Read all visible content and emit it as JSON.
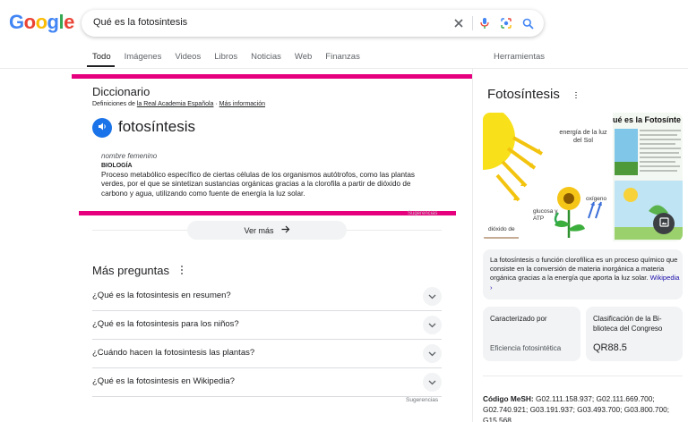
{
  "logo": {
    "text": "Google"
  },
  "search": {
    "query": "Qué es la fotosintesis"
  },
  "tabs": [
    {
      "label": "Todo"
    },
    {
      "label": "Imágenes"
    },
    {
      "label": "Videos"
    },
    {
      "label": "Libros"
    },
    {
      "label": "Noticias"
    },
    {
      "label": "Web"
    },
    {
      "label": "Finanzas"
    }
  ],
  "tools_label": "Herramientas",
  "dictionary": {
    "title": "Diccionario",
    "source_prefix": "Definiciones de ",
    "source_link": "la Real Academia Española",
    "separator": " · ",
    "more_info": "Más información",
    "word": "fotosíntesis",
    "gender": "nombre femenino",
    "domain": "BIOLOGÍA",
    "definition": "Proceso metabólico específico de ciertas células de los organismos autótrofos, como las plantas verdes, por el que se sintetizan sustancias orgánicas gracias a la clorofila a partir de dióxido de carbono y agua, utilizando como fuente de energía la luz solar.",
    "sugerencias": "Sugerencias",
    "ver_mas": "Ver más"
  },
  "paa": {
    "title": "Más preguntas",
    "questions": [
      "¿Qué es la fotosintesis en resumen?",
      "¿Qué es la fotosintesis para los niños?",
      "¿Cuándo hacen la fotosintesis las plantas?",
      "¿Qué es la fotosintesis en Wikipedia?"
    ],
    "sugerencias": "Sugerencias"
  },
  "knowledge_panel": {
    "title": "Fotosíntesis",
    "image1_labels": {
      "energy": "energía de la luz del Sol",
      "oxygen": "oxígeno",
      "glucose": "glucosa y ATP",
      "co2": "dióxido de"
    },
    "image2_title": "ué es la Fotosínte",
    "description": "La fotosíntesis o función clorofílica es un proceso químico que consiste en la conversión de materia inorgánica a materia orgánica gracias a la energía que aporta la luz solar.",
    "description_link": "Wikipedia",
    "card1": {
      "label": "Caracterizado por",
      "value": "Eficiencia fotosintética"
    },
    "card2": {
      "label_line1": "Clasificación de la Bi-",
      "label_line2": "blioteca del Congreso",
      "value": "QR88.5"
    },
    "mesh_label": "Código MeSH:",
    "mesh_value": " G02.111.158.937; G02.111.669.700; G02.740.921; G03.191.937; G03.493.700; G03.800.700; G15.568"
  },
  "colors": {
    "accent_blue": "#1a73e8",
    "highlight_magenta": "#e6007e"
  }
}
